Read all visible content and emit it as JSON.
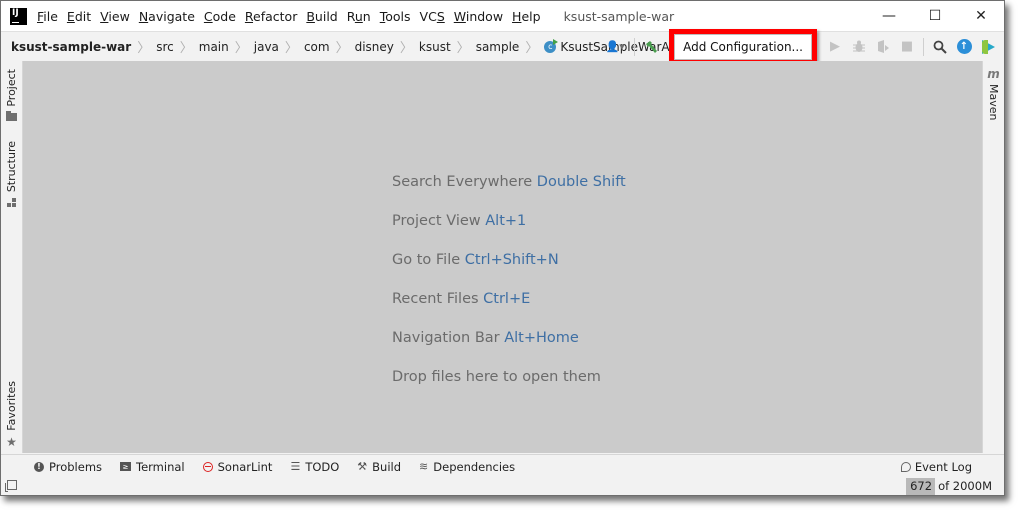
{
  "titlebar": {
    "app_logo": "IJ",
    "menu": [
      {
        "label": "File",
        "mnemonic": "F",
        "rest": "ile"
      },
      {
        "label": "Edit",
        "mnemonic": "E",
        "rest": "dit"
      },
      {
        "label": "View",
        "mnemonic": "V",
        "rest": "iew"
      },
      {
        "label": "Navigate",
        "mnemonic": "N",
        "rest": "avigate"
      },
      {
        "label": "Code",
        "mnemonic": "C",
        "rest": "ode"
      },
      {
        "label": "Refactor",
        "mnemonic": "R",
        "rest": "efactor"
      },
      {
        "label": "Build",
        "mnemonic": "B",
        "rest": "uild"
      },
      {
        "label": "Run",
        "pre": "R",
        "mnemonic": "u",
        "rest": "n"
      },
      {
        "label": "Tools",
        "mnemonic": "T",
        "rest": "ools"
      },
      {
        "label": "VCS",
        "pre": "VC",
        "mnemonic": "S",
        "rest": ""
      },
      {
        "label": "Window",
        "mnemonic": "W",
        "rest": "indow"
      },
      {
        "label": "Help",
        "mnemonic": "H",
        "rest": "elp"
      }
    ],
    "window_title": "ksust-sample-war",
    "controls": {
      "minimize": "—",
      "maximize": "☐",
      "close": "✕"
    }
  },
  "navbar": {
    "breadcrumbs": [
      "ksust-sample-war",
      "src",
      "main",
      "java",
      "com",
      "disney",
      "ksust",
      "sample"
    ],
    "current_class": "KsustSampleWarApplication",
    "class_icon_letter": "c",
    "separator": "〉",
    "run_config_label": "Add Configuration...",
    "icons": {
      "user": "👤▾",
      "build": "🔨",
      "run": "▶",
      "debug": "🐞",
      "coverage": "⛊",
      "stop": "■",
      "search": "⚲",
      "update": "↑"
    }
  },
  "left_strip": {
    "tabs": [
      {
        "label": "Project",
        "icon": "folder-icon"
      },
      {
        "label": "Structure",
        "icon": "structure-icon"
      },
      {
        "label": "Favorites",
        "icon": "star-icon",
        "glyph": "★"
      }
    ]
  },
  "right_strip": {
    "tabs": [
      {
        "label": "Maven",
        "glyph": "m"
      }
    ]
  },
  "editor": {
    "hints": [
      {
        "text": "Search Everywhere",
        "shortcut": "Double Shift"
      },
      {
        "text": "Project View",
        "shortcut": "Alt+1"
      },
      {
        "text": "Go to File",
        "shortcut": "Ctrl+Shift+N"
      },
      {
        "text": "Recent Files",
        "shortcut": "Ctrl+E"
      },
      {
        "text": "Navigation Bar",
        "shortcut": "Alt+Home"
      },
      {
        "text": "Drop files here to open them",
        "shortcut": ""
      }
    ]
  },
  "bottom_tools": {
    "items": [
      {
        "label": "Problems",
        "glyph": "!"
      },
      {
        "label": "Terminal",
        "glyph": "≥"
      },
      {
        "label": "SonarLint",
        "glyph": ""
      },
      {
        "label": "TODO",
        "glyph": "☰"
      },
      {
        "label": "Build",
        "glyph": "⚒"
      },
      {
        "label": "Dependencies",
        "glyph": "≋"
      }
    ],
    "event_log": "Event Log"
  },
  "statusbar": {
    "memory_used": "672",
    "memory_rest": "of 2000M"
  },
  "colors": {
    "highlight_box": "#ff0000",
    "shortcut_text": "#3e6fa4",
    "editor_bg": "#cbcbcb"
  }
}
